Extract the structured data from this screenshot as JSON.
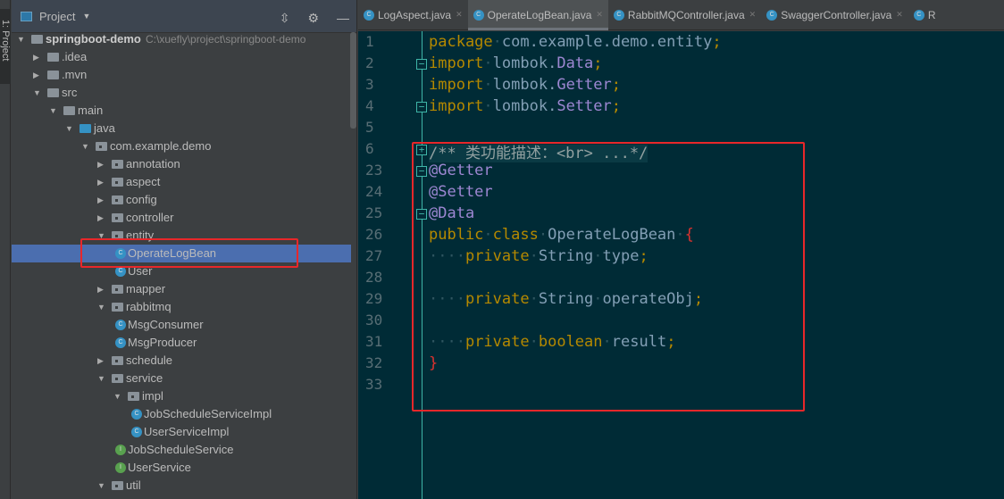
{
  "left_stripe": {
    "label": "1: Project"
  },
  "project_panel": {
    "title": "Project",
    "tree": [
      {
        "label": "springboot-demo",
        "path": "C:\\xuefly\\project\\springboot-demo",
        "depth": 0,
        "kind": "module",
        "state": "expanded"
      },
      {
        "label": ".idea",
        "depth": 1,
        "kind": "folder",
        "state": "collapsed"
      },
      {
        "label": ".mvn",
        "depth": 1,
        "kind": "folder",
        "state": "collapsed"
      },
      {
        "label": "src",
        "depth": 1,
        "kind": "folder",
        "state": "expanded"
      },
      {
        "label": "main",
        "depth": 2,
        "kind": "folder",
        "state": "expanded"
      },
      {
        "label": "java",
        "depth": 3,
        "kind": "source",
        "state": "expanded"
      },
      {
        "label": "com.example.demo",
        "depth": 4,
        "kind": "package",
        "state": "expanded"
      },
      {
        "label": "annotation",
        "depth": 5,
        "kind": "package",
        "state": "collapsed"
      },
      {
        "label": "aspect",
        "depth": 5,
        "kind": "package",
        "state": "collapsed"
      },
      {
        "label": "config",
        "depth": 5,
        "kind": "package",
        "state": "collapsed"
      },
      {
        "label": "controller",
        "depth": 5,
        "kind": "package",
        "state": "collapsed"
      },
      {
        "label": "entity",
        "depth": 5,
        "kind": "package",
        "state": "expanded"
      },
      {
        "label": "OperateLogBean",
        "depth": 6,
        "kind": "class",
        "selected": true
      },
      {
        "label": "User",
        "depth": 6,
        "kind": "class"
      },
      {
        "label": "mapper",
        "depth": 5,
        "kind": "package",
        "state": "collapsed"
      },
      {
        "label": "rabbitmq",
        "depth": 5,
        "kind": "package",
        "state": "expanded"
      },
      {
        "label": "MsgConsumer",
        "depth": 6,
        "kind": "class"
      },
      {
        "label": "MsgProducer",
        "depth": 6,
        "kind": "class"
      },
      {
        "label": "schedule",
        "depth": 5,
        "kind": "package",
        "state": "collapsed"
      },
      {
        "label": "service",
        "depth": 5,
        "kind": "package",
        "state": "expanded"
      },
      {
        "label": "impl",
        "depth": 6,
        "kind": "package",
        "state": "expanded"
      },
      {
        "label": "JobScheduleServiceImpl",
        "depth": 7,
        "kind": "class"
      },
      {
        "label": "UserServiceImpl",
        "depth": 7,
        "kind": "class"
      },
      {
        "label": "JobScheduleService",
        "depth": 6,
        "kind": "interface"
      },
      {
        "label": "UserService",
        "depth": 6,
        "kind": "interface"
      },
      {
        "label": "util",
        "depth": 5,
        "kind": "package",
        "state": "expanded"
      }
    ]
  },
  "tabs": [
    {
      "label": "LogAspect.java",
      "active": false
    },
    {
      "label": "OperateLogBean.java",
      "active": true
    },
    {
      "label": "RabbitMQController.java",
      "active": false
    },
    {
      "label": "SwaggerController.java",
      "active": false
    },
    {
      "label": "R",
      "active": false
    }
  ],
  "editor": {
    "lines": [
      {
        "n": "1",
        "tokens": [
          [
            "package",
            "kw"
          ],
          [
            "·",
            "ws"
          ],
          [
            "com.example.demo.entity",
            "id"
          ],
          [
            ";",
            "pn"
          ]
        ]
      },
      {
        "n": "2",
        "fold": "−",
        "tokens": [
          [
            "import",
            "kw"
          ],
          [
            "·",
            "ws"
          ],
          [
            "lombok.",
            "id"
          ],
          [
            "Data",
            "ty"
          ],
          [
            ";",
            "pn"
          ]
        ]
      },
      {
        "n": "3",
        "tokens": [
          [
            "import",
            "kw"
          ],
          [
            "·",
            "ws"
          ],
          [
            "lombok.",
            "id"
          ],
          [
            "Getter",
            "ty"
          ],
          [
            ";",
            "pn"
          ]
        ]
      },
      {
        "n": "4",
        "fold": "−",
        "tokens": [
          [
            "import",
            "kw"
          ],
          [
            "·",
            "ws"
          ],
          [
            "lombok.",
            "id"
          ],
          [
            "Setter",
            "ty"
          ],
          [
            ";",
            "pn"
          ]
        ]
      },
      {
        "n": "5",
        "tokens": []
      },
      {
        "n": "6",
        "fold": "+",
        "tokens": [
          [
            "/** 类功能描述：<br> ...*/",
            "cm"
          ]
        ]
      },
      {
        "n": "23",
        "fold": "−",
        "tokens": [
          [
            "@Getter",
            "ty"
          ]
        ]
      },
      {
        "n": "24",
        "tokens": [
          [
            "@Setter",
            "ty"
          ]
        ]
      },
      {
        "n": "25",
        "fold": "−",
        "tokens": [
          [
            "@Data",
            "ty"
          ]
        ]
      },
      {
        "n": "26",
        "tokens": [
          [
            "public",
            "kw"
          ],
          [
            "·",
            "ws"
          ],
          [
            "class",
            "kw"
          ],
          [
            "·",
            "ws"
          ],
          [
            "OperateLogBean",
            "id"
          ],
          [
            "·",
            "ws"
          ],
          [
            "{",
            "br"
          ]
        ]
      },
      {
        "n": "27",
        "tokens": [
          [
            "····",
            "ws"
          ],
          [
            "private",
            "kw"
          ],
          [
            "·",
            "ws"
          ],
          [
            "String",
            "id"
          ],
          [
            "·",
            "ws"
          ],
          [
            "type",
            "id"
          ],
          [
            ";",
            "pn"
          ]
        ]
      },
      {
        "n": "28",
        "tokens": []
      },
      {
        "n": "29",
        "tokens": [
          [
            "····",
            "ws"
          ],
          [
            "private",
            "kw"
          ],
          [
            "·",
            "ws"
          ],
          [
            "String",
            "id"
          ],
          [
            "·",
            "ws"
          ],
          [
            "operateObj",
            "id"
          ],
          [
            ";",
            "pn"
          ]
        ]
      },
      {
        "n": "30",
        "tokens": []
      },
      {
        "n": "31",
        "tokens": [
          [
            "····",
            "ws"
          ],
          [
            "private",
            "kw"
          ],
          [
            "·",
            "ws"
          ],
          [
            "boolean",
            "kw"
          ],
          [
            "·",
            "ws"
          ],
          [
            "result",
            "id"
          ],
          [
            ";",
            "pn"
          ]
        ]
      },
      {
        "n": "32",
        "tokens": [
          [
            "}",
            "br"
          ]
        ]
      },
      {
        "n": "33",
        "tokens": []
      }
    ]
  },
  "colors": {
    "selection": "#4b6eaf",
    "editor_bg": "#002b36",
    "highlight_box": "#e8272a",
    "keyword": "#b58900",
    "type": "#9d87d2",
    "identifier": "#839fb5"
  }
}
